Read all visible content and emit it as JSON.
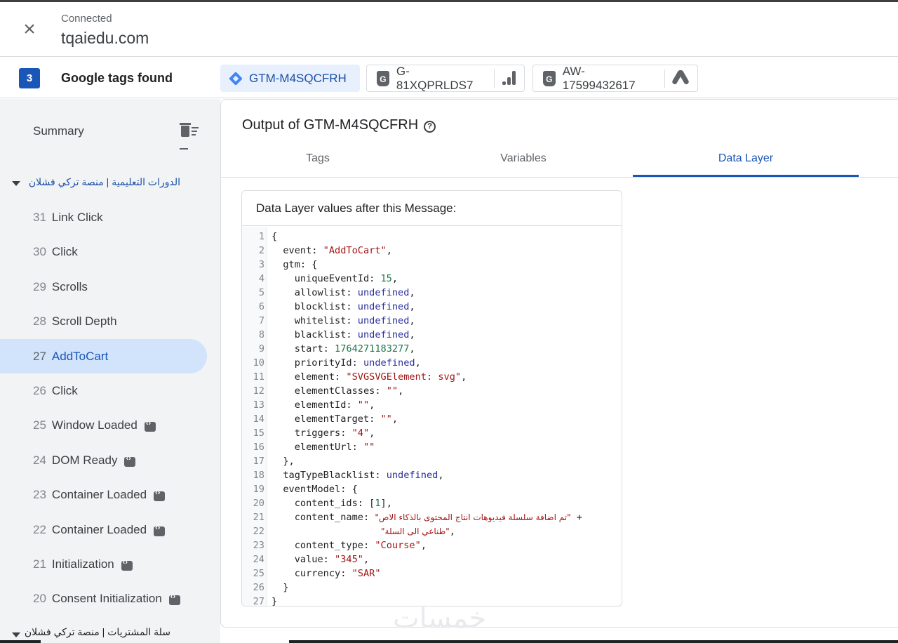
{
  "header": {
    "status": "Connected",
    "domain": "tqaiedu.com"
  },
  "tagbar": {
    "count": "3",
    "label": "Google tags found",
    "chips": [
      {
        "id": "GTM-M4SQCFRH",
        "icon": "gtm-icon",
        "active": true
      },
      {
        "id": "G-81XQPRLDS7",
        "icon": "google-tag-icon",
        "product_icon": "analytics-icon"
      },
      {
        "id": "AW-17599432617",
        "icon": "google-tag-icon",
        "product_icon": "google-ads-icon"
      }
    ]
  },
  "sidebar": {
    "summary": "Summary",
    "group1": "الدورات التعليمية | منصة تركي فشلان",
    "group2": "سلة المشتريات | منصة تركي فشلان",
    "events": [
      {
        "num": "31",
        "label": "Link Click"
      },
      {
        "num": "30",
        "label": "Click"
      },
      {
        "num": "29",
        "label": "Scrolls"
      },
      {
        "num": "28",
        "label": "Scroll Depth"
      },
      {
        "num": "27",
        "label": "AddToCart",
        "selected": true
      },
      {
        "num": "26",
        "label": "Click"
      },
      {
        "num": "25",
        "label": "Window Loaded",
        "code_icon": true
      },
      {
        "num": "24",
        "label": "DOM Ready",
        "code_icon": true
      },
      {
        "num": "23",
        "label": "Container Loaded",
        "code_icon": true
      },
      {
        "num": "22",
        "label": "Container Loaded",
        "code_icon": true
      },
      {
        "num": "21",
        "label": "Initialization",
        "code_icon": true
      },
      {
        "num": "20",
        "label": "Consent Initialization",
        "code_icon": true
      }
    ]
  },
  "main": {
    "title": "Output of GTM-M4SQCFRH",
    "tabs": [
      "Tags",
      "Variables",
      "Data Layer"
    ],
    "active_tab": "Data Layer",
    "card_title": "Data Layer values after this Message:"
  },
  "code": {
    "l1": "{",
    "l2k": "  event: ",
    "l2v": "\"AddToCart\"",
    "l2e": ",",
    "l3": "  gtm: {",
    "l4k": "    uniqueEventId: ",
    "l4v": "15",
    "l4e": ",",
    "l5k": "    allowlist: ",
    "l5v": "undefined",
    "l5e": ",",
    "l6k": "    blocklist: ",
    "l6v": "undefined",
    "l6e": ",",
    "l7k": "    whitelist: ",
    "l7v": "undefined",
    "l7e": ",",
    "l8k": "    blacklist: ",
    "l8v": "undefined",
    "l8e": ",",
    "l9k": "    start: ",
    "l9v": "1764271183277",
    "l9e": ",",
    "l10k": "    priorityId: ",
    "l10v": "undefined",
    "l10e": ",",
    "l11k": "    element: ",
    "l11v": "\"SVGSVGElement: svg\"",
    "l11e": ",",
    "l12k": "    elementClasses: ",
    "l12v": "\"\"",
    "l12e": ",",
    "l13k": "    elementId: ",
    "l13v": "\"\"",
    "l13e": ",",
    "l14k": "    elementTarget: ",
    "l14v": "\"\"",
    "l14e": ",",
    "l15k": "    triggers: ",
    "l15v": "\"4\"",
    "l15e": ",",
    "l16k": "    elementUrl: ",
    "l16v": "\"\"",
    "l17": "  },",
    "l18k": "  tagTypeBlacklist: ",
    "l18v": "undefined",
    "l18e": ",",
    "l19": "  eventModel: {",
    "l20k": "    content_ids: [",
    "l20v": "1",
    "l20e": "],",
    "l21k": "    content_name: ",
    "l21v": "\"تم اضافة سلسلة فيديوهات انتاج المحتوى بالذكاء الاص\"",
    "l21e": " +",
    "l22v": "\"طناعي الى السلة\"",
    "l22e": ",",
    "l23k": "    content_type: ",
    "l23v": "\"Course\"",
    "l23e": ",",
    "l24k": "    value: ",
    "l24v": "\"345\"",
    "l24e": ",",
    "l25k": "    currency: ",
    "l25v": "\"SAR\"",
    "l26": "  }",
    "l27": "}"
  },
  "watermark": "خمسات"
}
